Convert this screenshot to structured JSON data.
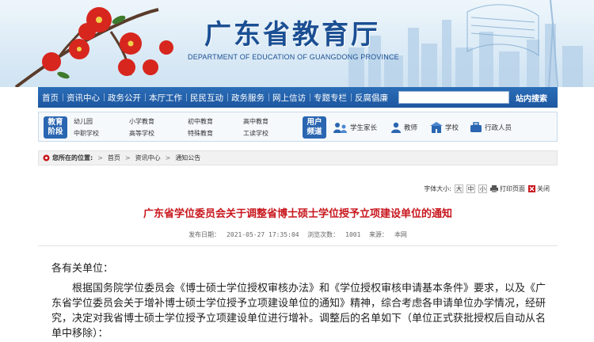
{
  "header": {
    "title": "广东省教育厅",
    "subtitle": "DEPARTMENT OF EDUCATION OF GUANGDONG PROVINCE"
  },
  "nav": {
    "items": [
      "首页",
      "资讯中心",
      "政务公开",
      "本厅工作",
      "民民互动",
      "政务服务",
      "网上信访",
      "专题专栏",
      "反腐倡廉"
    ],
    "search_placeholder": "",
    "search_button": "站内搜索"
  },
  "categories": {
    "stage_badge_line1": "教育",
    "stage_badge_line2": "阶段",
    "stages": [
      "幼儿园",
      "小学教育",
      "初中教育",
      "高中教育",
      "中职学校",
      "高等学校",
      "特殊教育",
      "工读学校"
    ],
    "user_badge_line1": "用户",
    "user_badge_line2": "频道",
    "users": [
      {
        "label": "学生家长",
        "icon": "parent-icon"
      },
      {
        "label": "教师",
        "icon": "teacher-icon"
      },
      {
        "label": "学校",
        "icon": "school-icon"
      },
      {
        "label": "行政人员",
        "icon": "briefcase-icon"
      }
    ]
  },
  "breadcrumb": {
    "label": "您所在的位置:",
    "items": [
      "首页",
      "资讯中心",
      "通知公告"
    ]
  },
  "tools": {
    "font_label": "字体大小:",
    "sizes": [
      "大",
      "中",
      "小"
    ],
    "print": "打印页面",
    "close": "关闭"
  },
  "article": {
    "title": "广东省学位委员会关于调整省博士硕士学位授予立项建设单位的通知",
    "publish_label": "发布日期：",
    "publish_date": "2021-05-27 17:35:04",
    "views_label": "浏览次数：",
    "views": "1001",
    "source_label": "来源：",
    "source": "本网",
    "greeting": "各有关单位：",
    "body": "根据国务院学位委员会《博士硕士学位授权审核办法》和《学位授权审核申请基本条件》要求，以及《广东省学位委员会关于增补博士硕士学位授予立项建设单位的通知》精神，综合考虑各申请单位办学情况，经研究，决定对我省博士硕士学位授予立项建设单位进行增补。调整后的名单如下（单位正式获批授权后自动从名单中移除）："
  },
  "colors": {
    "brand_blue": "#1b4f93",
    "nav_blue": "#1d57a0",
    "title_red": "#c8161d"
  }
}
